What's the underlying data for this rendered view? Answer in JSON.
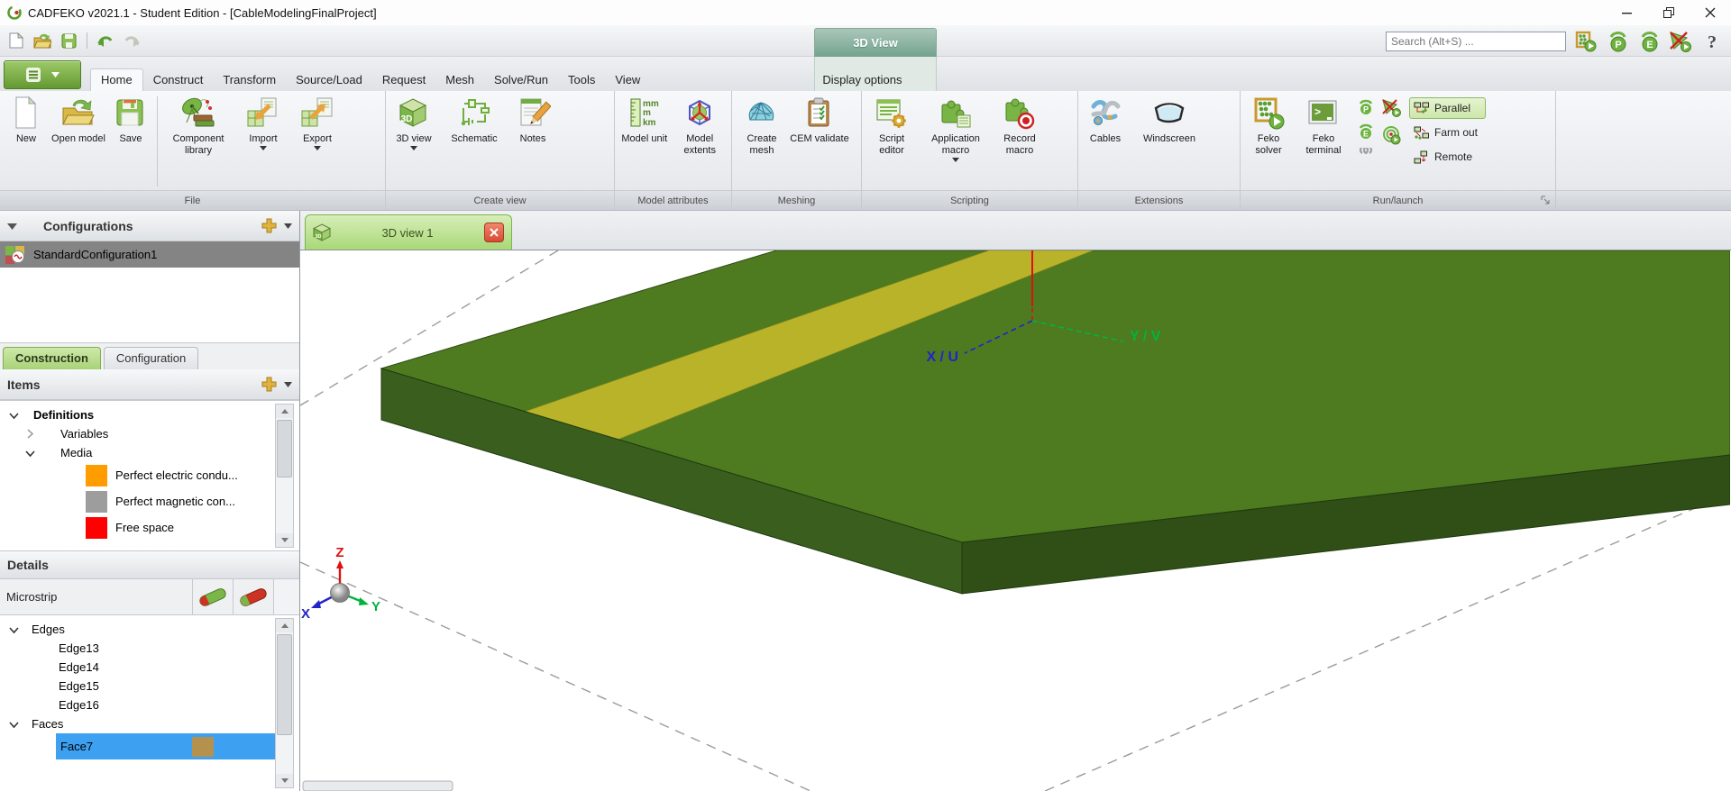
{
  "window": {
    "title": "CADFEKO v2021.1 - Student Edition - [CableModelingFinalProject]"
  },
  "search": {
    "placeholder": "Search (Alt+S) ..."
  },
  "contextual": {
    "header": "3D View",
    "tab_label": "Display options"
  },
  "tabs": [
    "Home",
    "Construct",
    "Transform",
    "Source/Load",
    "Request",
    "Mesh",
    "Solve/Run",
    "Tools",
    "View"
  ],
  "ribbon": {
    "cube_text": "3D",
    "units": [
      "mm",
      "m",
      "km"
    ],
    "groups": [
      {
        "caption": "File",
        "buttons": [
          {
            "label": "New"
          },
          {
            "label": "Open model"
          },
          {
            "label": "Save"
          },
          {
            "label": "Component library"
          },
          {
            "label": "Import"
          },
          {
            "label": "Export"
          }
        ]
      },
      {
        "caption": "Create view",
        "buttons": [
          {
            "label": "3D view"
          },
          {
            "label": "Schematic"
          },
          {
            "label": "Notes"
          }
        ]
      },
      {
        "caption": "Model attributes",
        "buttons": [
          {
            "label": "Model unit"
          },
          {
            "label": "Model extents"
          }
        ]
      },
      {
        "caption": "Meshing",
        "buttons": [
          {
            "label": "Create mesh"
          },
          {
            "label": "CEM validate"
          }
        ]
      },
      {
        "caption": "Scripting",
        "buttons": [
          {
            "label": "Script editor"
          },
          {
            "label": "Application macro"
          },
          {
            "label": "Record macro"
          }
        ]
      },
      {
        "caption": "Extensions",
        "buttons": [
          {
            "label": "Cables"
          },
          {
            "label": "Windscreen"
          }
        ]
      },
      {
        "caption": "Run/launch",
        "buttons": [
          {
            "label": "Feko solver"
          },
          {
            "label": "Feko terminal"
          }
        ],
        "stack": [
          {
            "label": "Parallel"
          },
          {
            "label": "Farm out"
          },
          {
            "label": "Remote"
          }
        ]
      }
    ]
  },
  "sidebar": {
    "configurations_header": "Configurations",
    "configuration_item": "StandardConfiguration1",
    "tabs": {
      "construction": "Construction",
      "configuration": "Configuration"
    },
    "items_header": "Items",
    "tree": {
      "definitions": "Definitions",
      "variables": "Variables",
      "media": "Media",
      "media_items": [
        {
          "label": "Perfect electric condu...",
          "swatch": "#FF9C00"
        },
        {
          "label": "Perfect magnetic con...",
          "swatch": "#9D9D9D"
        },
        {
          "label": "Free space",
          "swatch": "#FF0000"
        }
      ]
    },
    "details_header": "Details",
    "details_title": "Microstrip",
    "details": {
      "edges_label": "Edges",
      "edges": [
        "Edge13",
        "Edge14",
        "Edge15",
        "Edge16"
      ],
      "faces_label": "Faces",
      "face_item": "Face7",
      "face_swatch": "#B5914E"
    }
  },
  "viewport": {
    "tab_label": "3D view 1",
    "labels": {
      "xu": "X / U",
      "yv": "Y / V",
      "z": "Z",
      "x": "X",
      "y": "Y"
    },
    "colors": {
      "board_top": "#4E7B20",
      "board_end": "#3A5E1E",
      "board_front": "#2F4F17",
      "microstrip": "#B9B32A",
      "axis_x_blue": "#2323CC",
      "axis_y_green": "#00B43C",
      "axis_z_red": "#DD1111"
    }
  }
}
